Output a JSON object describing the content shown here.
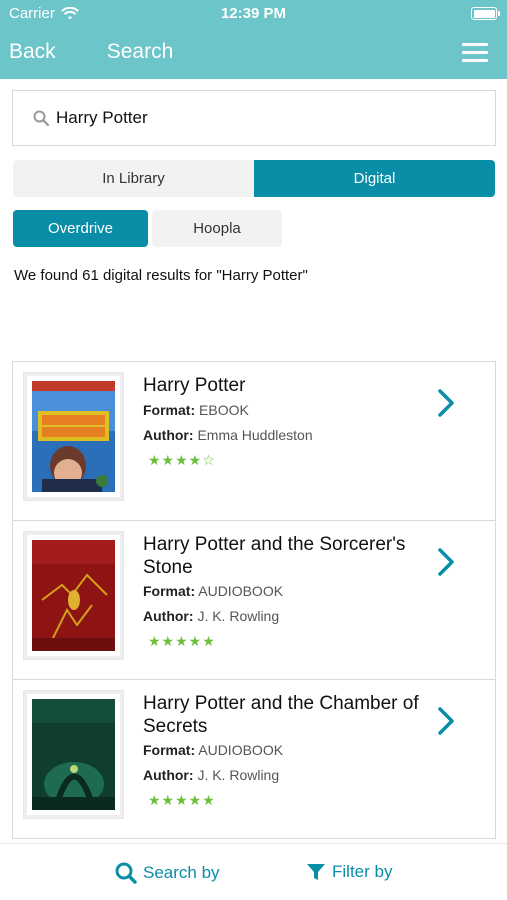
{
  "status_bar": {
    "carrier": "Carrier",
    "time": "12:39 PM",
    "wifi_icon": "wifi-icon",
    "battery_icon": "battery-icon"
  },
  "nav": {
    "back_label": "Back",
    "title": "Search",
    "menu_icon": "hamburger-menu-icon"
  },
  "search": {
    "icon": "search-icon",
    "value": "Harry Potter"
  },
  "segment": {
    "in_library": "In Library",
    "digital": "Digital",
    "selected": "Digital"
  },
  "providers": {
    "overdrive": "Overdrive",
    "hoopla": "Hoopla",
    "selected": "Overdrive"
  },
  "results_text": "We found 61 digital results for \"Harry Potter\"",
  "results": [
    {
      "title": "Harry Potter",
      "format_label": "Format:",
      "format": "EBOOK",
      "author_label": "Author:",
      "author": "Emma Huddleston",
      "stars": "★★★★☆",
      "rating": 4
    },
    {
      "title": "Harry Potter and the Sorcerer's Stone",
      "format_label": "Format:",
      "format": "AUDIOBOOK",
      "author_label": "Author:",
      "author": "J. K. Rowling",
      "stars": "★★★★★",
      "rating": 5
    },
    {
      "title": "Harry Potter and the Chamber of Secrets",
      "format_label": "Format:",
      "format": "AUDIOBOOK",
      "author_label": "Author:",
      "author": "J. K. Rowling",
      "stars": "★★★★★",
      "rating": 5
    }
  ],
  "bottom": {
    "search_by": "Search by",
    "filter_by": "Filter by"
  },
  "colors": {
    "header": "#6cc5c8",
    "accent": "#0a8ea8",
    "stars": "#6cbf3c"
  }
}
